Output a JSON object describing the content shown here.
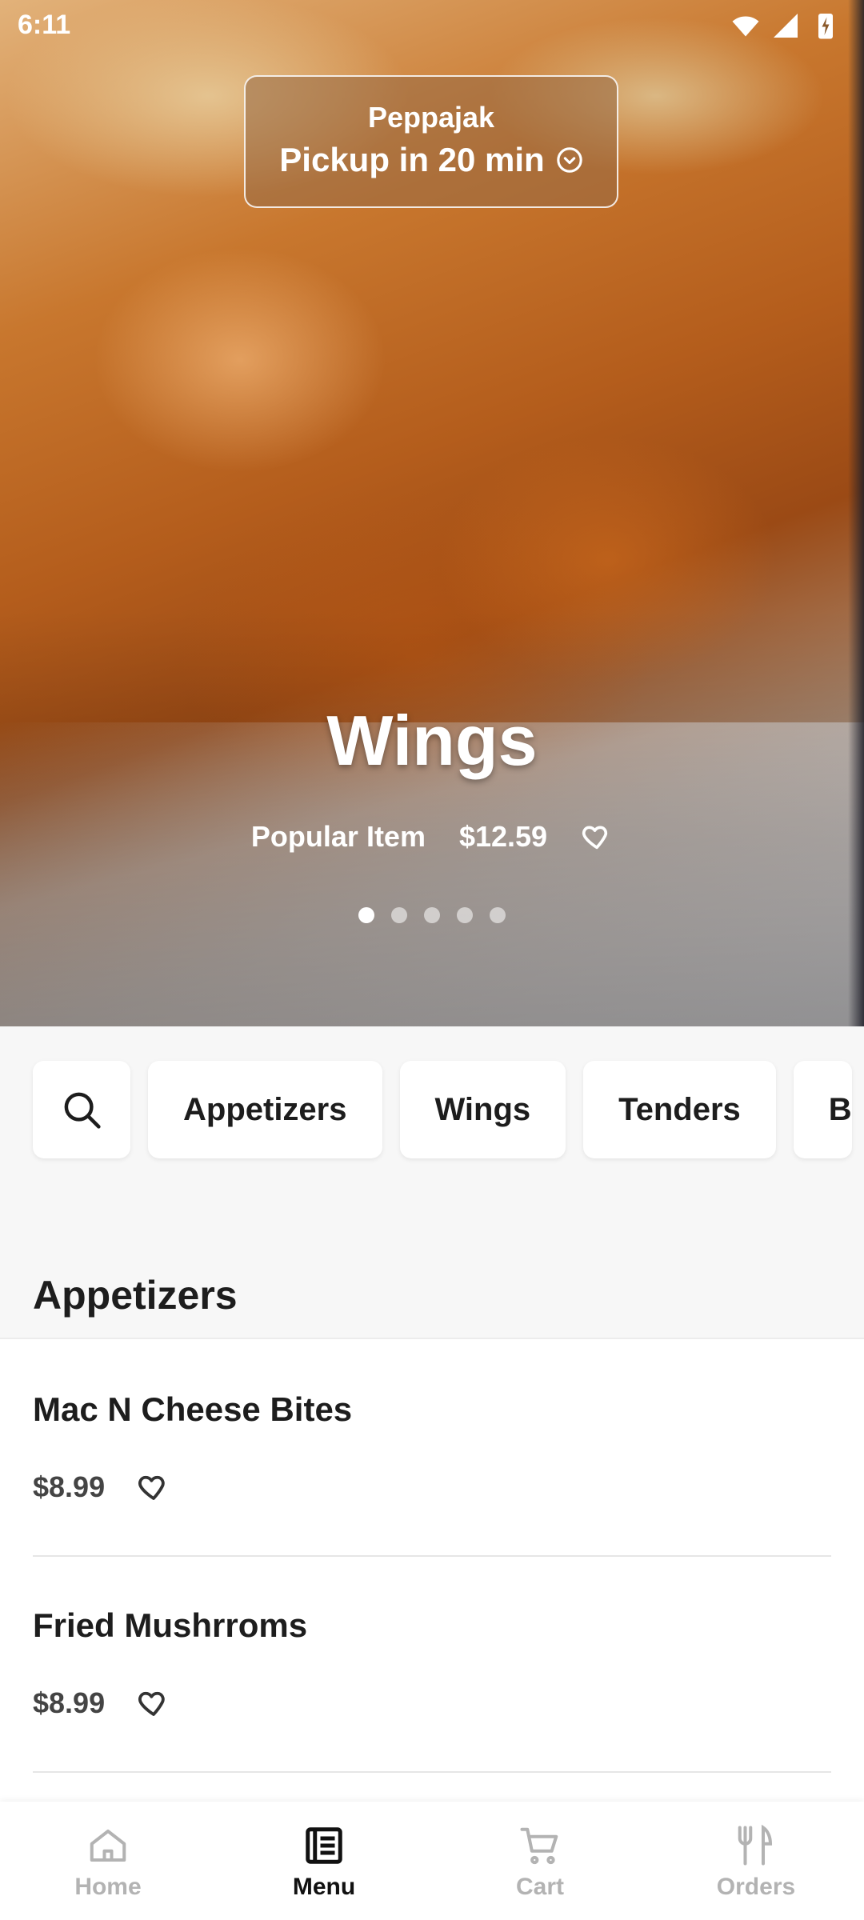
{
  "status_bar": {
    "time": "6:11"
  },
  "pickup": {
    "store": "Peppajak",
    "eta": "Pickup in 20 min"
  },
  "hero": {
    "title": "Wings",
    "tag": "Popular Item",
    "price": "$12.59",
    "slides_total": 5,
    "slide_active": 1
  },
  "categories": [
    "Appetizers",
    "Wings",
    "Tenders",
    "B"
  ],
  "section": {
    "title": "Appetizers"
  },
  "items": [
    {
      "name": "Mac N Cheese Bites",
      "price": "$8.99"
    },
    {
      "name": "Fried Mushrroms",
      "price": "$8.99"
    }
  ],
  "nav": [
    {
      "label": "Home",
      "icon": "home-icon",
      "active": false
    },
    {
      "label": "Menu",
      "icon": "menu-icon",
      "active": true
    },
    {
      "label": "Cart",
      "icon": "cart-icon",
      "active": false
    },
    {
      "label": "Orders",
      "icon": "orders-icon",
      "active": false
    }
  ],
  "colors": {
    "active": "#111111",
    "inactive": "#b3b3b3",
    "background": "#f7f7f7"
  }
}
